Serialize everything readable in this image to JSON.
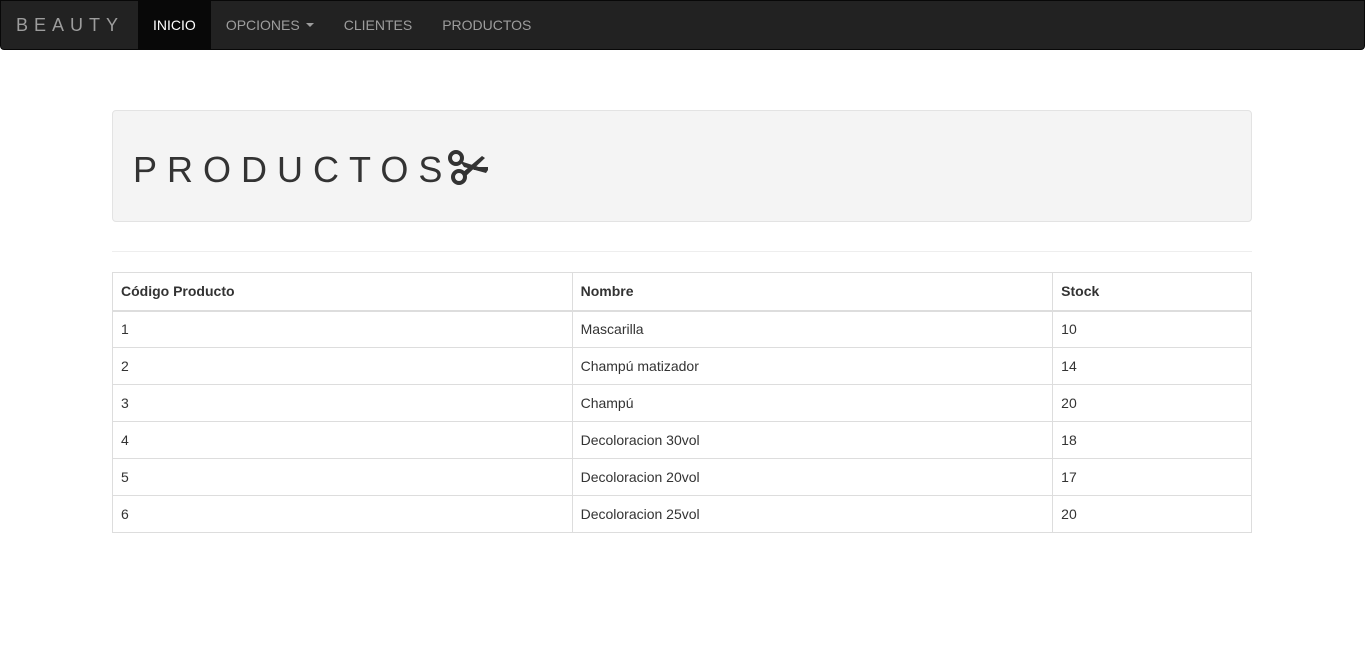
{
  "navbar": {
    "brand": "BEAUTY",
    "items": [
      {
        "label": "INICIO",
        "active": true
      },
      {
        "label": "OPCIONES",
        "dropdown": true
      },
      {
        "label": "CLIENTES"
      },
      {
        "label": "PRODUCTOS"
      }
    ]
  },
  "header": {
    "title": "PRODUCTOS",
    "icon": "scissors-icon"
  },
  "table": {
    "columns": [
      "Código Producto",
      "Nombre",
      "Stock"
    ],
    "rows": [
      [
        "1",
        "Mascarilla",
        "10"
      ],
      [
        "2",
        "Champú matizador",
        "14"
      ],
      [
        "3",
        "Champú",
        "20"
      ],
      [
        "4",
        "Decoloracion 30vol",
        "18"
      ],
      [
        "5",
        "Decoloracion 20vol",
        "17"
      ],
      [
        "6",
        "Decoloracion 25vol",
        "20"
      ]
    ]
  },
  "colors": {
    "navbar_bg": "#222222",
    "navbar_active_bg": "#080808",
    "jumbotron_bg": "#f4f4f4"
  }
}
